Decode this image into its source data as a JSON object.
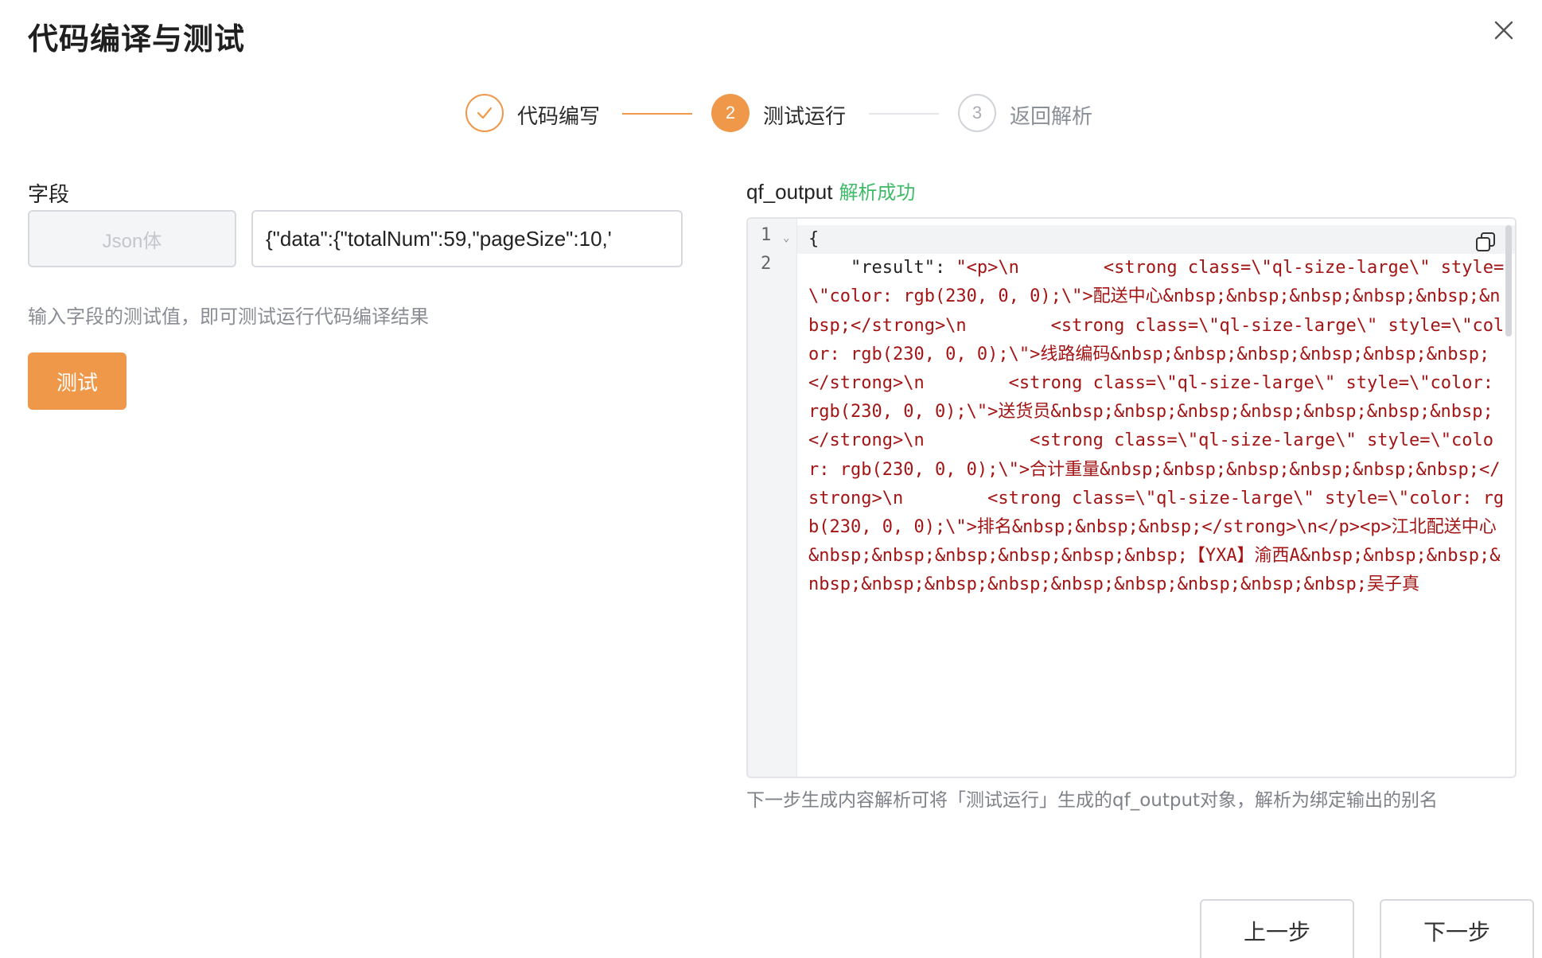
{
  "dialog": {
    "title": "代码编译与测试",
    "close_icon": "close-icon"
  },
  "steps": [
    {
      "label": "代码编写",
      "state": "done",
      "marker": "✓"
    },
    {
      "label": "测试运行",
      "state": "active",
      "marker": "2"
    },
    {
      "label": "返回解析",
      "state": "pending",
      "marker": "3"
    }
  ],
  "colors": {
    "accent": "#f0984a",
    "success": "#3fbb68",
    "code_string": "#a31515"
  },
  "input_panel": {
    "field_label": "字段",
    "type_value": "Json体",
    "value": "{\"data\":{\"totalNum\":59,\"pageSize\":10,'",
    "hint": "输入字段的测试值，即可测试运行代码编译结果",
    "test_button": "测试"
  },
  "output_panel": {
    "label": "qf_output",
    "status": "解析成功",
    "line_numbers": [
      "1",
      "2"
    ],
    "code_line1": "{",
    "code_line2_key": "    \"result\": ",
    "code_line2_value": "\"<p>\\n        <strong class=\\\"ql-size-large\\\" style=\\\"color: rgb(230, 0, 0);\\\">配送中心&nbsp;&nbsp;&nbsp;&nbsp;&nbsp;&nbsp;</strong>\\n        <strong class=\\\"ql-size-large\\\" style=\\\"color: rgb(230, 0, 0);\\\">线路编码&nbsp;&nbsp;&nbsp;&nbsp;&nbsp;&nbsp;</strong>\\n        <strong class=\\\"ql-size-large\\\" style=\\\"color: rgb(230, 0, 0);\\\">送货员&nbsp;&nbsp;&nbsp;&nbsp;&nbsp;&nbsp;&nbsp;</strong>\\n          <strong class=\\\"ql-size-large\\\" style=\\\"color: rgb(230, 0, 0);\\\">合计重量&nbsp;&nbsp;&nbsp;&nbsp;&nbsp;&nbsp;</strong>\\n        <strong class=\\\"ql-size-large\\\" style=\\\"color: rgb(230, 0, 0);\\\">排名&nbsp;&nbsp;&nbsp;</strong>\\n</p><p>江北配送中心&nbsp;&nbsp;&nbsp;&nbsp;&nbsp;&nbsp;【YXA】渝西A&nbsp;&nbsp;&nbsp;&nbsp;&nbsp;&nbsp;&nbsp;&nbsp;&nbsp;&nbsp;&nbsp;&nbsp;吴子真",
    "copy_icon": "copy-icon",
    "footnote": "下一步生成内容解析可将「测试运行」生成的qf_output对象，解析为绑定输出的别名"
  },
  "footer": {
    "prev_button": "上一步",
    "next_button": "下一步"
  }
}
